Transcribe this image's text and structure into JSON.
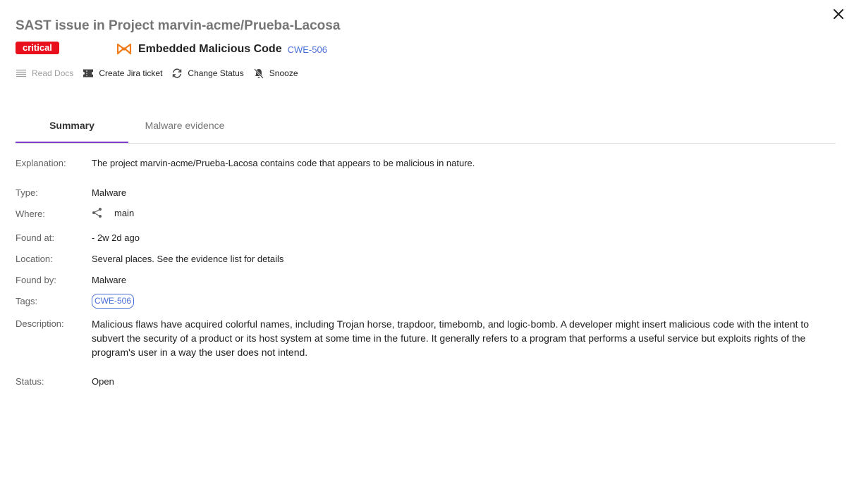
{
  "header": {
    "title": "SAST issue in Project marvin-acme/Prueba-Lacosa",
    "severity": "critical",
    "issue_name": "Embedded Malicious Code",
    "cwe_link": "CWE-506"
  },
  "toolbar": {
    "read_docs": "Read Docs",
    "create_jira": "Create Jira ticket",
    "change_status": "Change Status",
    "snooze": "Snooze"
  },
  "tabs": {
    "summary": "Summary",
    "malware_evidence": "Malware evidence"
  },
  "details": {
    "explanation_label": "Explanation:",
    "explanation": "The project marvin-acme/Prueba-Lacosa contains code that appears to be malicious in nature.",
    "type_label": "Type:",
    "type": "Malware",
    "where_label": "Where:",
    "where": "main",
    "found_at_label": "Found at:",
    "found_at": "- 2w 2d ago",
    "location_label": "Location:",
    "location": "Several places. See the evidence list for details",
    "found_by_label": "Found by:",
    "found_by": "Malware",
    "tags_label": "Tags:",
    "tag": "CWE-506",
    "description_label": "Description:",
    "description": "Malicious flaws have acquired colorful names, including Trojan horse, trapdoor, timebomb, and logic-bomb. A developer might insert malicious code with the intent to subvert the security of a product or its host system at some time in the future. It generally refers to a program that performs a useful service but exploits rights of the program's user in a way the user does not intend.",
    "status_label": "Status:",
    "status": "Open"
  },
  "colors": {
    "critical": "#e8101c",
    "link": "#4a6fd8",
    "tab_active": "#7e3fc9",
    "issue_icon": "#f07c1b"
  },
  "icons": [
    "close-icon",
    "malware-bowtie-icon",
    "read-docs-icon",
    "jira-ticket-icon",
    "change-status-icon",
    "snooze-bell-icon",
    "branch-share-icon"
  ]
}
